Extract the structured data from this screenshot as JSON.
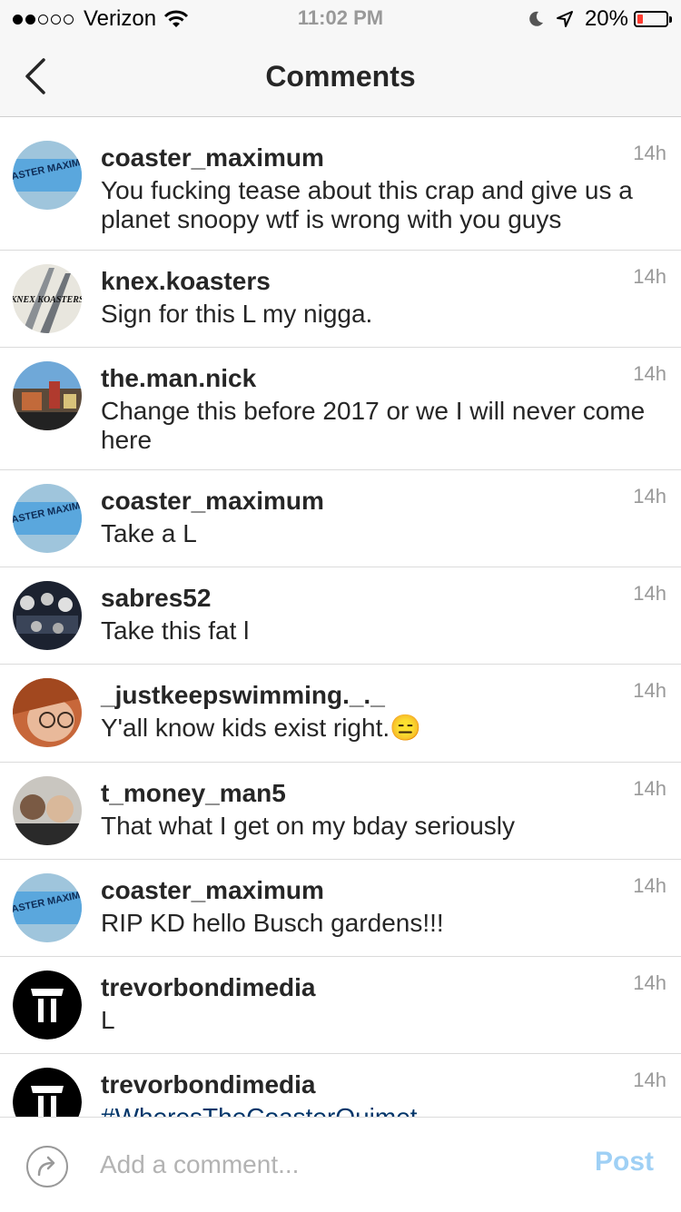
{
  "status_bar": {
    "carrier": "Verizon",
    "time": "11:02 PM",
    "battery_percent": "20%",
    "battery_level": 0.2,
    "signal_bars_filled": 2,
    "signal_bars_total": 5
  },
  "nav": {
    "title": "Comments"
  },
  "comments": [
    {
      "username": "coaster_maximum",
      "text": "You fucking tease about this crap and give us a planet snoopy wtf is wrong with you guys",
      "time": "14h"
    },
    {
      "username": "knex.koasters",
      "text": "Sign for this L my nigga.",
      "time": "14h"
    },
    {
      "username": "the.man.nick",
      "text": "Change this before 2017 or we I will never come here",
      "time": "14h"
    },
    {
      "username": "coaster_maximum",
      "text": "Take a L",
      "time": "14h"
    },
    {
      "username": "sabres52",
      "text": "Take this fat l",
      "time": "14h"
    },
    {
      "username": "_justkeepswimming._._",
      "text": "Y'all know kids exist right.😑",
      "time": "14h"
    },
    {
      "username": "t_money_man5",
      "text": "That what I get on my bday seriously",
      "time": "14h"
    },
    {
      "username": "coaster_maximum",
      "text": "RIP KD hello Busch gardens!!!",
      "time": "14h"
    },
    {
      "username": "trevorbondimedia",
      "text": "L",
      "time": "14h"
    },
    {
      "username": "trevorbondimedia",
      "text": "#WheresTheCoasterQuimet",
      "time": "14h"
    }
  ],
  "avatars": {
    "coaster_maximum_label": "COASTER MAXIMUM",
    "knex_label": "KNEX KOASTERS"
  },
  "footer": {
    "placeholder": "Add a comment...",
    "post_label": "Post"
  },
  "colors": {
    "post_inactive": "#9fd0f5",
    "hashtag": "#003569",
    "battery_low": "#ff3b30"
  }
}
